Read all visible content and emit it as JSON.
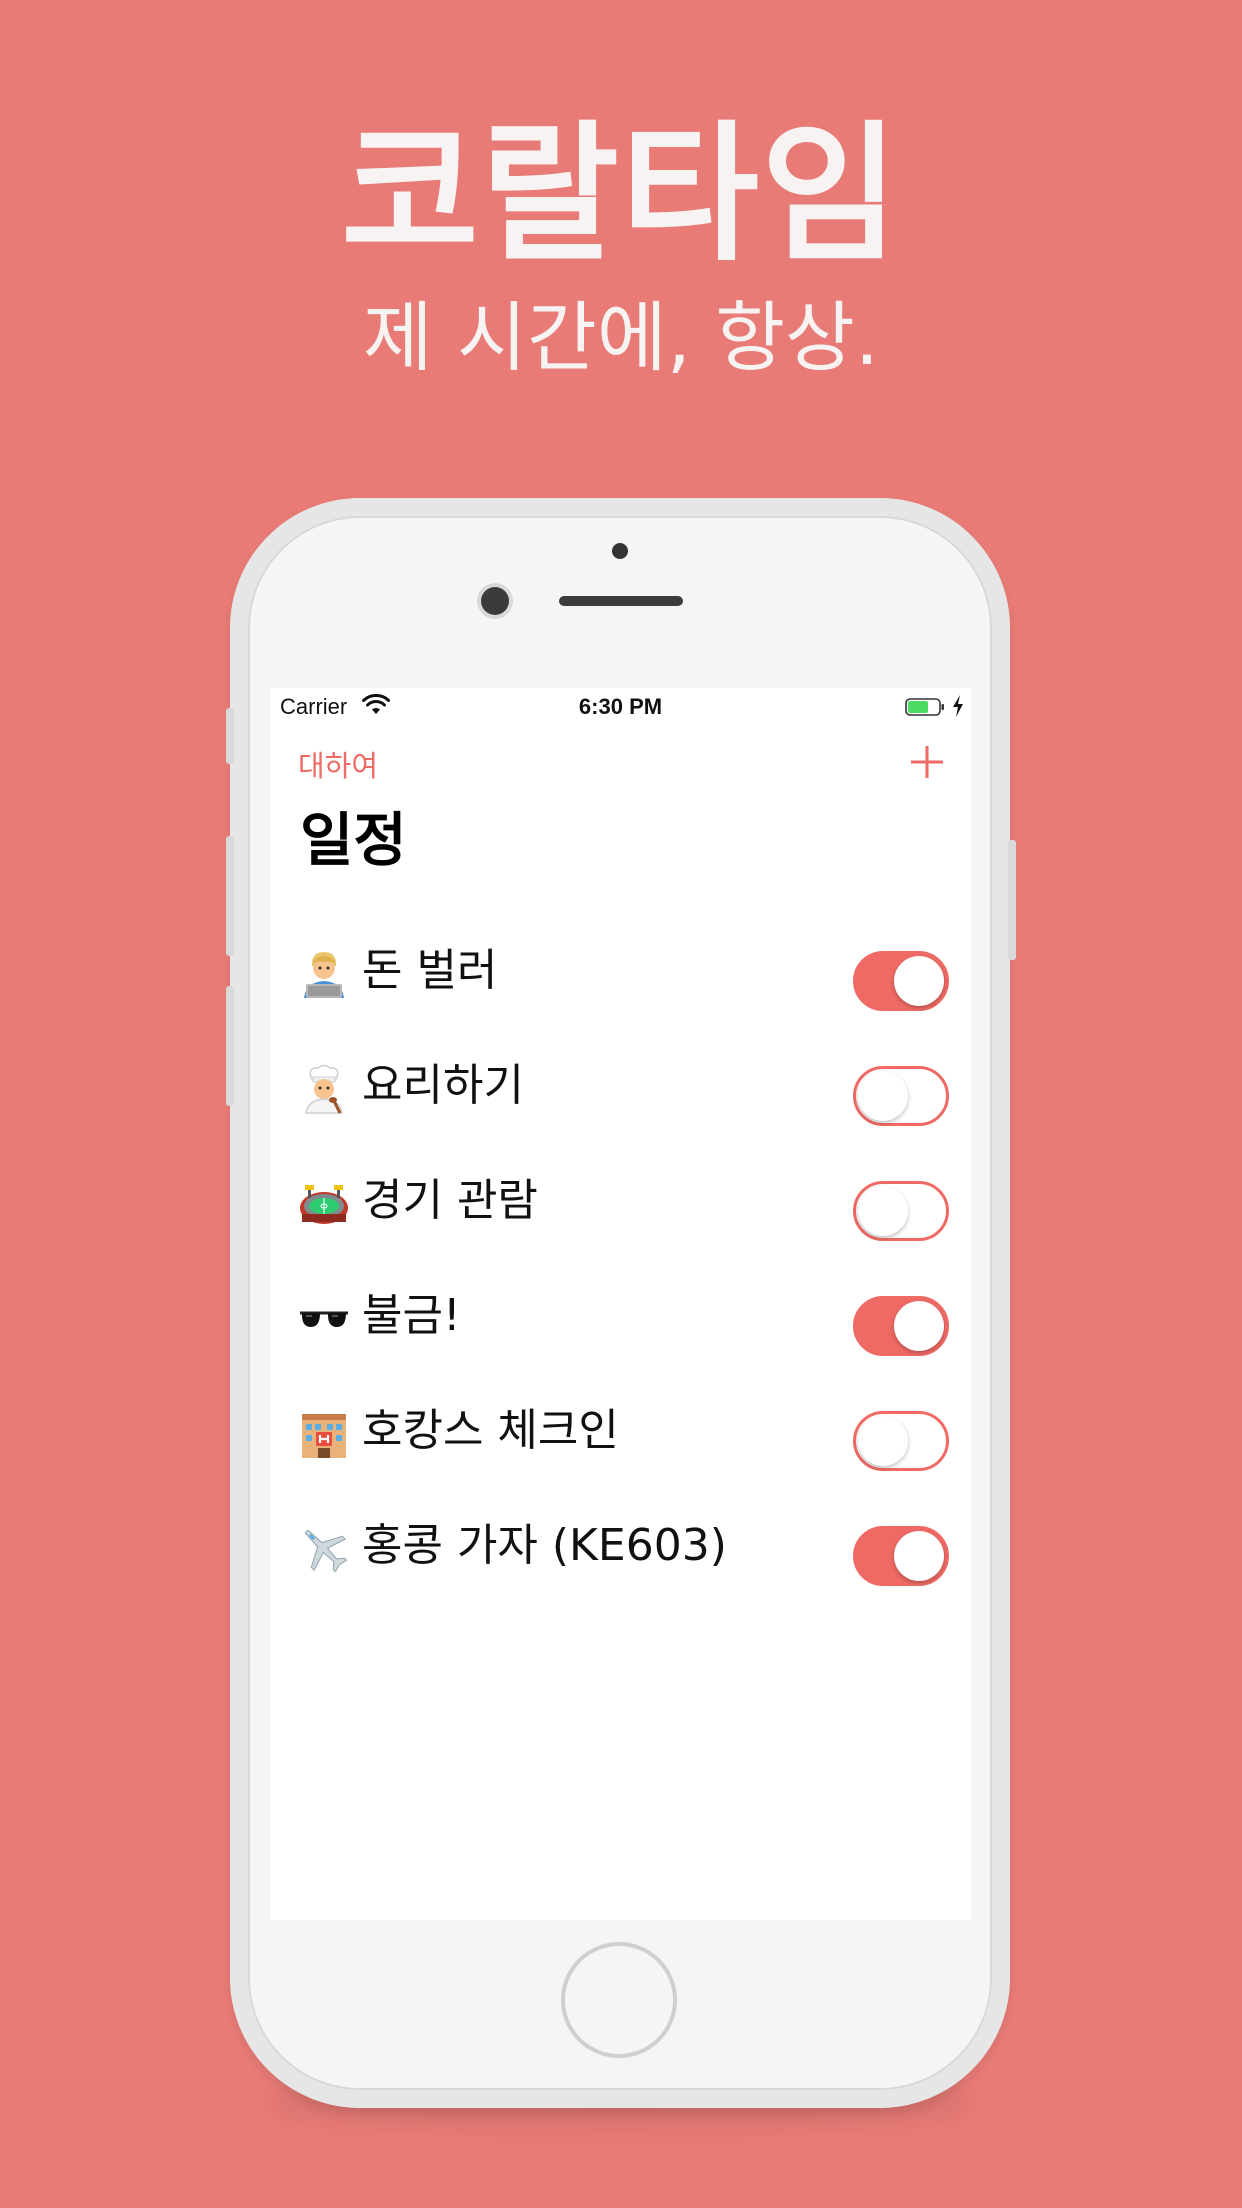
{
  "hero": {
    "title": "코랄타임",
    "subtitle": "제 시간에, 항상."
  },
  "status_bar": {
    "carrier": "Carrier",
    "time": "6:30 PM",
    "battery_color": "#4cd964"
  },
  "nav": {
    "left_label": "대하여",
    "title": "일정"
  },
  "accent": "#ef6a64",
  "items": [
    {
      "emoji": "laptop-technologist-icon",
      "label": "돈 벌러",
      "on": true
    },
    {
      "emoji": "chef-icon",
      "label": "요리하기",
      "on": false
    },
    {
      "emoji": "stadium-icon",
      "label": "경기 관람",
      "on": false
    },
    {
      "emoji": "sunglasses-icon",
      "label": "불금!",
      "on": true
    },
    {
      "emoji": "hotel-icon",
      "label": "호캉스 체크인",
      "on": false
    },
    {
      "emoji": "airplane-icon",
      "label": "홍콩 가자 (KE603)",
      "on": true
    }
  ]
}
